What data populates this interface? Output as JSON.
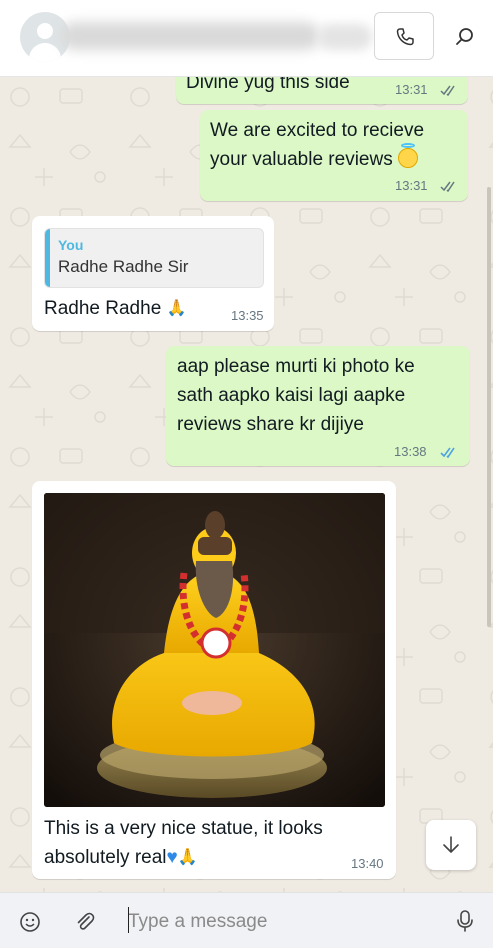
{
  "header": {
    "call_icon": "phone-icon",
    "search_icon": "search-icon"
  },
  "messages": [
    {
      "type": "out",
      "text": "Divine yug this side",
      "time": "13:31",
      "status": "read"
    },
    {
      "type": "out",
      "text": "We are excited to recieve\nyour valuable reviews",
      "emoji": "smiling-face-with-halo",
      "time": "13:31",
      "status": "read"
    },
    {
      "type": "in",
      "quote": {
        "author": "You",
        "text": "Radhe Radhe Sir"
      },
      "text": "Radhe Radhe",
      "emoji": "folded-hands",
      "time": "13:35"
    },
    {
      "type": "out",
      "text": "aap please murti ki photo ke\nsath aapko kaisi lagi aapke\nreviews share kr dijiye",
      "time": "13:38",
      "status": "read-blue"
    },
    {
      "type": "in",
      "image": "statue-photo",
      "caption_line1": "This is a very nice statue, it looks",
      "caption_line2": "absolutely real",
      "emoji": "blue-heart folded-hands",
      "time": "13:40"
    }
  ],
  "composer": {
    "placeholder": "Type a message",
    "emoji_icon": "emoji-icon",
    "attach_icon": "paperclip-icon",
    "mic_icon": "microphone-icon"
  },
  "colors": {
    "outgoing_bubble": "#dcf8c6",
    "incoming_bubble": "#ffffff",
    "chat_background": "#efeae2",
    "quote_accent": "#4fb8e0",
    "read_tick_blue": "#4fa3e0"
  }
}
